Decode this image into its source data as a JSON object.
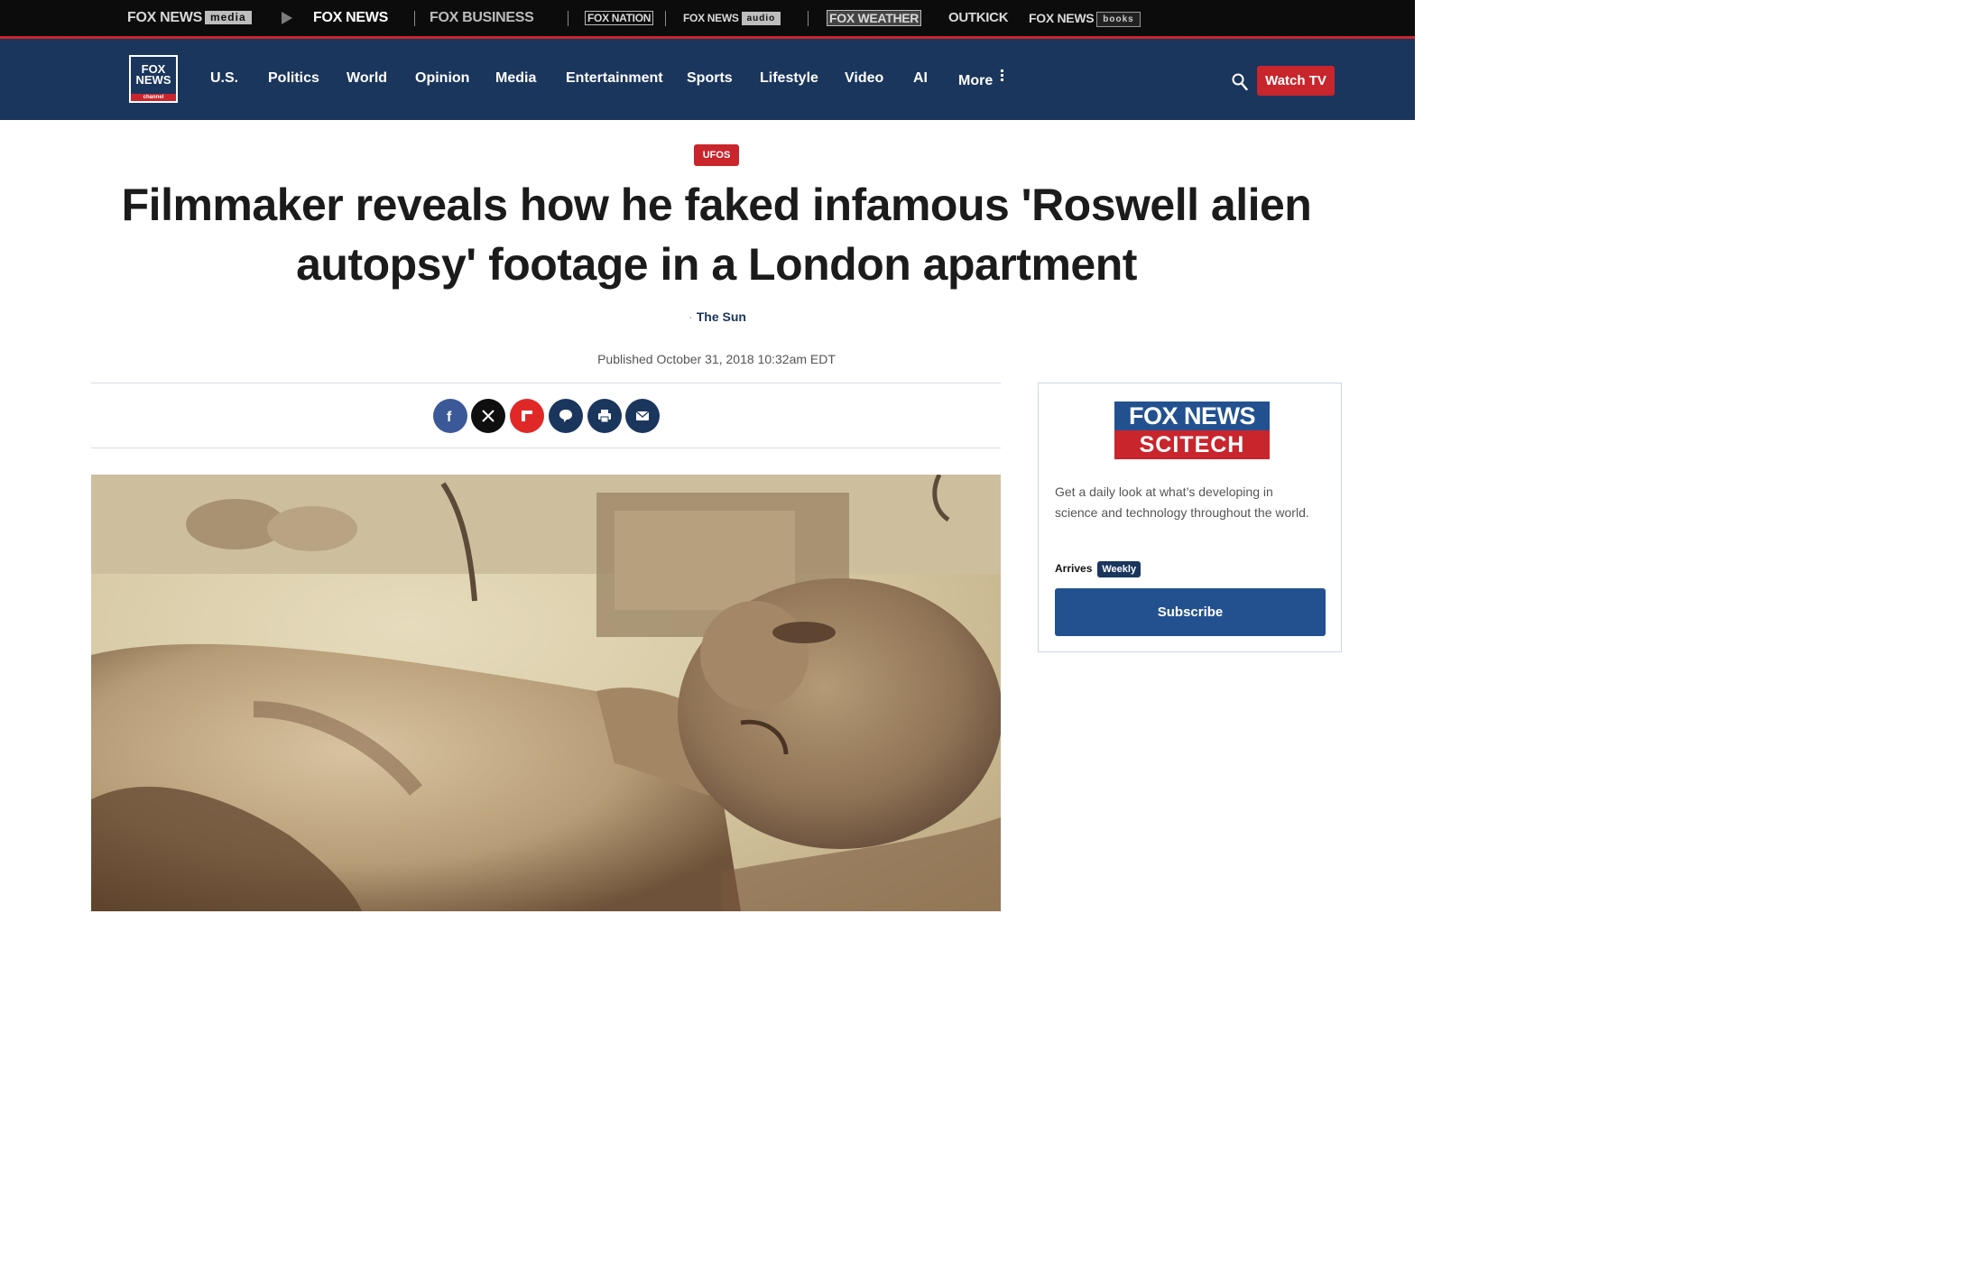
{
  "network_bar": {
    "fox_news_media": "FOX NEWS",
    "fox_news_media_tag": "media",
    "fox_news": "FOX NEWS",
    "fox_business": "FOX BUSINESS",
    "fox_nation": "FOX NATION",
    "fox_news_audio": "FOX NEWS",
    "fox_news_audio_tag": "audio",
    "fox_weather": "FOX WEATHER",
    "outkick": "OUTKICK",
    "fox_news_books": "FOX NEWS",
    "fox_news_books_tag": "books"
  },
  "header": {
    "logo_line1": "FOX",
    "logo_line2": "NEWS",
    "logo_line3": "channel",
    "nav": [
      "U.S.",
      "Politics",
      "World",
      "Opinion",
      "Media",
      "Entertainment",
      "Sports",
      "Lifestyle",
      "Video",
      "AI",
      "More"
    ],
    "watch_tv": "Watch TV"
  },
  "article": {
    "category": "UFOS",
    "headline": "Filmmaker reveals how he faked infamous 'Roswell alien autopsy' footage in a London apartment",
    "source": "The Sun",
    "published": "Published October 31, 2018 10:32am EDT"
  },
  "share_icons": [
    "facebook-icon",
    "x-icon",
    "flipboard-icon",
    "comment-icon",
    "print-icon",
    "email-icon"
  ],
  "newsletter": {
    "logo_top": "FOX NEWS",
    "logo_bottom": "SCITECH",
    "description": "Get a daily look at what’s developing in science and technology throughout the world.",
    "arrives_label": "Arrives",
    "arrives_value": "Weekly",
    "subscribe": "Subscribe"
  },
  "colors": {
    "nav_blue": "#1b365d",
    "accent_red": "#c9252c",
    "button_blue": "#23518f"
  }
}
